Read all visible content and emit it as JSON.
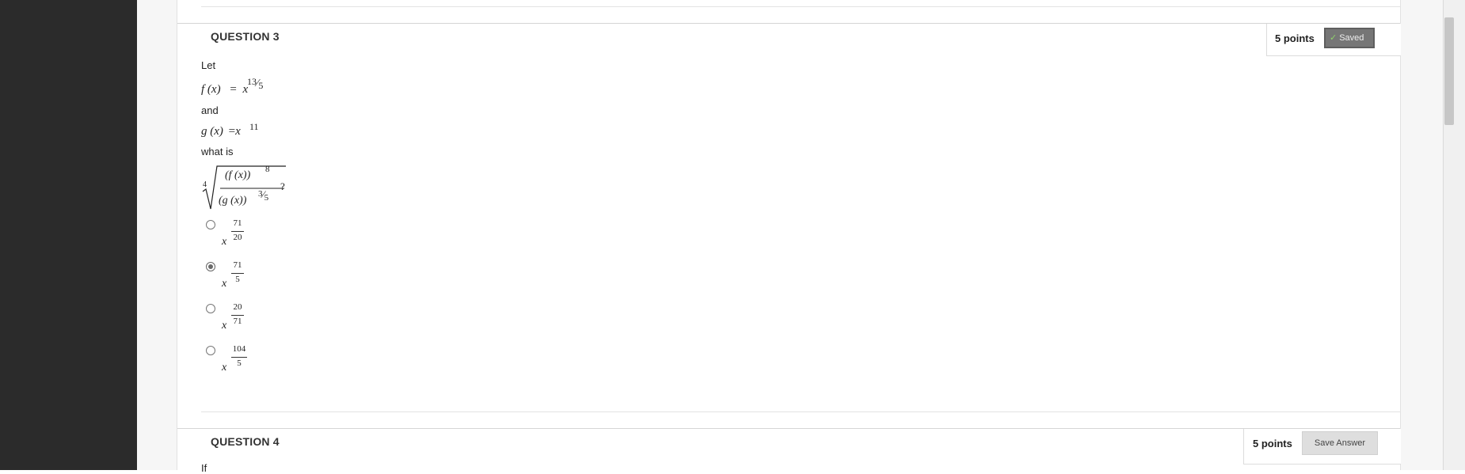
{
  "question3": {
    "title": "QUESTION 3",
    "points": "5 points",
    "saved_label": "Saved",
    "intro": "Let",
    "f_def": {
      "lhs": "f (x)",
      "eq": "=",
      "base": "x",
      "exp_num": "13",
      "exp_slash": "⁄",
      "exp_den": "5"
    },
    "and": "and",
    "g_def": {
      "lhs": "g (x)",
      "eq": "=",
      "base": "x",
      "exp": "11"
    },
    "what_is": "what is",
    "expr": {
      "root_index": "4",
      "num": "(f (x))",
      "num_exp": "8",
      "den": "(g (x))",
      "den_exp_num": "3",
      "den_exp_den": "5",
      "qmark": "?"
    },
    "options": [
      {
        "base": "x",
        "num": "71",
        "den": "20",
        "selected": false
      },
      {
        "base": "x",
        "num": "71",
        "den": "5",
        "selected": true
      },
      {
        "base": "x",
        "num": "20",
        "den": "71",
        "selected": false
      },
      {
        "base": "x",
        "num": "104",
        "den": "5",
        "selected": false
      }
    ]
  },
  "question4": {
    "title": "QUESTION 4",
    "points": "5 points",
    "save_answer_label": "Save Answer",
    "intro": "If"
  }
}
